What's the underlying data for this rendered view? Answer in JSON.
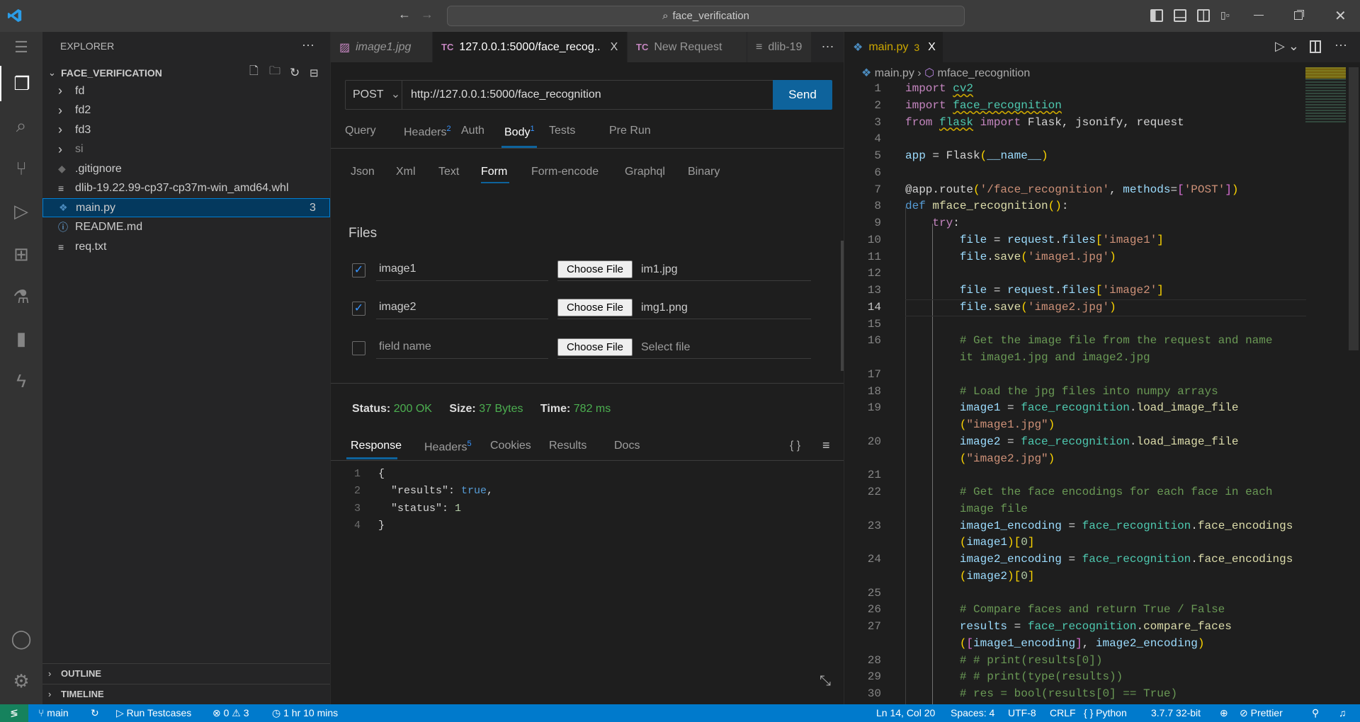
{
  "titlebar": {
    "search": "face_verification",
    "back": "←",
    "forward": "→"
  },
  "sidebar": {
    "title": "EXPLORER",
    "more": "···",
    "project": "FACE_VERIFICATION",
    "items": [
      {
        "label": "fd",
        "type": "folder"
      },
      {
        "label": "fd2",
        "type": "folder"
      },
      {
        "label": "fd3",
        "type": "folder"
      },
      {
        "label": "si",
        "type": "folder"
      },
      {
        "label": ".gitignore",
        "type": "git"
      },
      {
        "label": "dlib-19.22.99-cp37-cp37m-win_amd64.whl",
        "type": "file"
      },
      {
        "label": "main.py",
        "type": "python",
        "badge": "3",
        "selected": true
      },
      {
        "label": "README.md",
        "type": "info"
      },
      {
        "label": "req.txt",
        "type": "file"
      }
    ],
    "outline": "OUTLINE",
    "timeline": "TIMELINE"
  },
  "thunder": {
    "tabs": [
      {
        "label": "image1.jpg",
        "icon": "image"
      },
      {
        "label": "127.0.0.1:5000/face_recog..",
        "icon": "TC",
        "active": true,
        "close": "X"
      },
      {
        "label": "New Request",
        "icon": "TC"
      },
      {
        "label": "dlib-19",
        "icon": "file"
      }
    ],
    "tabs_more": "···",
    "method": "POST",
    "url": "http://127.0.0.1:5000/face_recognition",
    "send": "Send",
    "request_tabs": [
      {
        "label": "Query"
      },
      {
        "label": "Headers",
        "count": "2"
      },
      {
        "label": "Auth"
      },
      {
        "label": "Body",
        "count": "1",
        "active": true
      },
      {
        "label": "Tests"
      },
      {
        "label": "Pre Run"
      }
    ],
    "body_tabs": [
      "Json",
      "Xml",
      "Text",
      "Form",
      "Form-encode",
      "Graphql",
      "Binary"
    ],
    "body_active": "Form",
    "files_title": "Files",
    "files": [
      {
        "checked": true,
        "name": "image1",
        "button": "Choose File",
        "file": "im1.jpg"
      },
      {
        "checked": true,
        "name": "image2",
        "button": "Choose File",
        "file": "img1.png"
      },
      {
        "checked": false,
        "name": "field name",
        "button": "Choose File",
        "file": "Select file"
      }
    ],
    "status": {
      "status_label": "Status:",
      "status": "200 OK",
      "size_label": "Size:",
      "size": "37 Bytes",
      "time_label": "Time:",
      "time": "782 ms"
    },
    "response_tabs": [
      {
        "label": "Response",
        "active": true
      },
      {
        "label": "Headers",
        "count": "5"
      },
      {
        "label": "Cookies"
      },
      {
        "label": "Results"
      },
      {
        "label": "Docs"
      }
    ],
    "braces": "{ }",
    "response_lines": [
      {
        "n": "1",
        "t": [
          [
            "p",
            "{"
          ]
        ]
      },
      {
        "n": "2",
        "t": [
          [
            "p",
            "  \"results\": "
          ],
          [
            "b",
            "true"
          ],
          [
            "p",
            ","
          ]
        ]
      },
      {
        "n": "3",
        "t": [
          [
            "p",
            "  \"status\": "
          ],
          [
            "n",
            "1"
          ]
        ]
      },
      {
        "n": "4",
        "t": [
          [
            "p",
            "}"
          ]
        ]
      }
    ]
  },
  "editor": {
    "tab": {
      "label": "main.py",
      "badge": "3",
      "close": "X"
    },
    "breadcrumb": [
      "main.py",
      "mface_recognition"
    ],
    "current_line": "14",
    "rows": [
      {
        "n": "1",
        "t": [
          [
            "k",
            "import"
          ],
          [
            "p",
            " "
          ],
          [
            "m sq",
            "cv2"
          ]
        ]
      },
      {
        "n": "2",
        "t": [
          [
            "k",
            "import"
          ],
          [
            "p",
            " "
          ],
          [
            "m sq",
            "face_recognition"
          ]
        ]
      },
      {
        "n": "3",
        "t": [
          [
            "k",
            "from"
          ],
          [
            "p",
            " "
          ],
          [
            "m sq",
            "flask"
          ],
          [
            "p",
            " "
          ],
          [
            "k",
            "import"
          ],
          [
            "p",
            " Flask, jsonify, request"
          ]
        ]
      },
      {
        "n": "4",
        "t": []
      },
      {
        "n": "5",
        "t": [
          [
            "v",
            "app"
          ],
          [
            "p",
            " = Flask"
          ],
          [
            "y",
            "("
          ],
          [
            "v",
            "__name__"
          ],
          [
            "y",
            ")"
          ]
        ]
      },
      {
        "n": "6",
        "t": []
      },
      {
        "n": "7",
        "t": [
          [
            "p",
            "@app.route"
          ],
          [
            "y",
            "("
          ],
          [
            "s",
            "'/face_recognition'"
          ],
          [
            "p",
            ", "
          ],
          [
            "v",
            "methods"
          ],
          [
            "p",
            "="
          ],
          [
            "pk",
            "["
          ],
          [
            "s",
            "'POST'"
          ],
          [
            "pk",
            "]"
          ],
          [
            "y",
            ")"
          ]
        ]
      },
      {
        "n": "8",
        "t": [
          [
            "b",
            "def"
          ],
          [
            "p",
            " "
          ],
          [
            "f",
            "mface_recognition"
          ],
          [
            "y",
            "()"
          ],
          [
            "p",
            ":"
          ]
        ]
      },
      {
        "n": "9",
        "t": [
          [
            "p",
            "    "
          ],
          [
            "k",
            "try"
          ],
          [
            "p",
            ":"
          ]
        ]
      },
      {
        "n": "10",
        "t": [
          [
            "p",
            "        "
          ],
          [
            "v",
            "file"
          ],
          [
            "p",
            " = "
          ],
          [
            "v",
            "request"
          ],
          [
            "p",
            "."
          ],
          [
            "v",
            "files"
          ],
          [
            "y",
            "["
          ],
          [
            "s",
            "'image1'"
          ],
          [
            "y",
            "]"
          ]
        ]
      },
      {
        "n": "11",
        "t": [
          [
            "p",
            "        "
          ],
          [
            "v",
            "file"
          ],
          [
            "p",
            "."
          ],
          [
            "f",
            "save"
          ],
          [
            "y",
            "("
          ],
          [
            "s",
            "'image1.jpg'"
          ],
          [
            "y",
            ")"
          ]
        ]
      },
      {
        "n": "12",
        "t": []
      },
      {
        "n": "13",
        "t": [
          [
            "p",
            "        "
          ],
          [
            "v",
            "file"
          ],
          [
            "p",
            " = "
          ],
          [
            "v",
            "request"
          ],
          [
            "p",
            "."
          ],
          [
            "v",
            "files"
          ],
          [
            "y",
            "["
          ],
          [
            "s",
            "'image2'"
          ],
          [
            "y",
            "]"
          ]
        ]
      },
      {
        "n": "14",
        "t": [
          [
            "p",
            "        "
          ],
          [
            "v",
            "file"
          ],
          [
            "p",
            "."
          ],
          [
            "f",
            "save"
          ],
          [
            "y",
            "("
          ],
          [
            "s",
            "'image2.jpg'"
          ],
          [
            "y",
            ")"
          ]
        ]
      },
      {
        "n": "15",
        "t": []
      },
      {
        "n": "16",
        "t": [
          [
            "p",
            "        "
          ],
          [
            "c",
            "# Get the image file from the request and name"
          ]
        ]
      },
      {
        "n": "",
        "t": [
          [
            "p",
            "        "
          ],
          [
            "c",
            "it image1.jpg and image2.jpg"
          ]
        ]
      },
      {
        "n": "17",
        "t": []
      },
      {
        "n": "18",
        "t": [
          [
            "p",
            "        "
          ],
          [
            "c",
            "# Load the jpg files into numpy arrays"
          ]
        ]
      },
      {
        "n": "19",
        "t": [
          [
            "p",
            "        "
          ],
          [
            "v",
            "image1"
          ],
          [
            "p",
            " = "
          ],
          [
            "m",
            "face_recognition"
          ],
          [
            "p",
            "."
          ],
          [
            "f",
            "load_image_file"
          ]
        ]
      },
      {
        "n": "",
        "t": [
          [
            "p",
            "        "
          ],
          [
            "y",
            "("
          ],
          [
            "s",
            "\"image1.jpg\""
          ],
          [
            "y",
            ")"
          ]
        ]
      },
      {
        "n": "20",
        "t": [
          [
            "p",
            "        "
          ],
          [
            "v",
            "image2"
          ],
          [
            "p",
            " = "
          ],
          [
            "m",
            "face_recognition"
          ],
          [
            "p",
            "."
          ],
          [
            "f",
            "load_image_file"
          ]
        ]
      },
      {
        "n": "",
        "t": [
          [
            "p",
            "        "
          ],
          [
            "y",
            "("
          ],
          [
            "s",
            "\"image2.jpg\""
          ],
          [
            "y",
            ")"
          ]
        ]
      },
      {
        "n": "21",
        "t": []
      },
      {
        "n": "22",
        "t": [
          [
            "p",
            "        "
          ],
          [
            "c",
            "# Get the face encodings for each face in each"
          ]
        ]
      },
      {
        "n": "",
        "t": [
          [
            "p",
            "        "
          ],
          [
            "c",
            "image file"
          ]
        ]
      },
      {
        "n": "23",
        "t": [
          [
            "p",
            "        "
          ],
          [
            "v",
            "image1_encoding"
          ],
          [
            "p",
            " = "
          ],
          [
            "m",
            "face_recognition"
          ],
          [
            "p",
            "."
          ],
          [
            "f",
            "face_encodings"
          ]
        ]
      },
      {
        "n": "",
        "t": [
          [
            "p",
            "        "
          ],
          [
            "y",
            "("
          ],
          [
            "v",
            "image1"
          ],
          [
            "y",
            ")"
          ],
          [
            "y",
            "["
          ],
          [
            "n",
            "0"
          ],
          [
            "y",
            "]"
          ]
        ]
      },
      {
        "n": "24",
        "t": [
          [
            "p",
            "        "
          ],
          [
            "v",
            "image2_encoding"
          ],
          [
            "p",
            " = "
          ],
          [
            "m",
            "face_recognition"
          ],
          [
            "p",
            "."
          ],
          [
            "f",
            "face_encodings"
          ]
        ]
      },
      {
        "n": "",
        "t": [
          [
            "p",
            "        "
          ],
          [
            "y",
            "("
          ],
          [
            "v",
            "image2"
          ],
          [
            "y",
            ")"
          ],
          [
            "y",
            "["
          ],
          [
            "n",
            "0"
          ],
          [
            "y",
            "]"
          ]
        ]
      },
      {
        "n": "25",
        "t": []
      },
      {
        "n": "26",
        "t": [
          [
            "p",
            "        "
          ],
          [
            "c",
            "# Compare faces and return True / False"
          ]
        ]
      },
      {
        "n": "27",
        "t": [
          [
            "p",
            "        "
          ],
          [
            "v",
            "results"
          ],
          [
            "p",
            " = "
          ],
          [
            "m",
            "face_recognition"
          ],
          [
            "p",
            "."
          ],
          [
            "f",
            "compare_faces"
          ]
        ]
      },
      {
        "n": "",
        "t": [
          [
            "p",
            "        "
          ],
          [
            "y",
            "("
          ],
          [
            "pk",
            "["
          ],
          [
            "v",
            "image1_encoding"
          ],
          [
            "pk",
            "]"
          ],
          [
            "p",
            ", "
          ],
          [
            "v",
            "image2_encoding"
          ],
          [
            "y",
            ")"
          ]
        ]
      },
      {
        "n": "28",
        "t": [
          [
            "p",
            "        "
          ],
          [
            "c",
            "# # print(results[0])"
          ]
        ]
      },
      {
        "n": "29",
        "t": [
          [
            "p",
            "        "
          ],
          [
            "c",
            "# # print(type(results))"
          ]
        ]
      },
      {
        "n": "30",
        "t": [
          [
            "p",
            "        "
          ],
          [
            "c",
            "# res = bool(results[0] == True)"
          ]
        ]
      }
    ]
  },
  "statusbar": {
    "branch": "main",
    "run": "Run Testcases",
    "errors": "0",
    "warnings": "3",
    "time": "1 hr 10 mins",
    "position": "Ln 14, Col 20",
    "spaces": "Spaces: 4",
    "encoding": "UTF-8",
    "eol": "CRLF",
    "language": "Python",
    "interpreter": "3.7.7 32-bit",
    "prettier": "Prettier"
  },
  "colors": {
    "accent": "#007acc",
    "status_ok": "#4caf50",
    "tc_purple": "#c586c0",
    "send": "#0e639c"
  }
}
